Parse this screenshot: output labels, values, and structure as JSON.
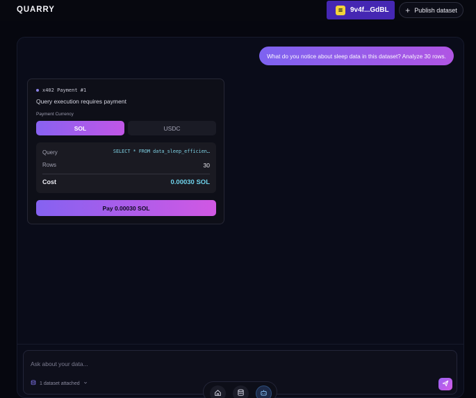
{
  "header": {
    "logo": "QUARRY",
    "wallet_label": "9v4f...GdBL",
    "publish_label": "Publish dataset"
  },
  "chat": {
    "user_message": "What do you notice about sleep data in this dataset? Analyze 30 rows."
  },
  "payment": {
    "tag": "x402 Payment #1",
    "description": "Query execution requires payment",
    "currency_label": "Payment Currency",
    "currencies": [
      {
        "label": "SOL",
        "selected": true
      },
      {
        "label": "USDC",
        "selected": false
      }
    ],
    "query_label": "Query",
    "query_value": "SELECT * FROM data_sleep_efficien…",
    "rows_label": "Rows",
    "rows_value": "30",
    "cost_label": "Cost",
    "cost_value": "0.00030 SOL",
    "pay_button": "Pay 0.00030 SOL"
  },
  "input": {
    "placeholder": "Ask about your data...",
    "attached_label": "1 dataset attached"
  },
  "colors": {
    "accent_start": "#8562f1",
    "accent_end": "#d158e3",
    "wallet_bg": "#4527b3",
    "cost_color": "#6fd2ea",
    "background": "#06070f"
  },
  "icons": {
    "wallet": "solana-icon",
    "publish": "plus-icon",
    "attached": "database-icon",
    "send": "send-icon",
    "nav": [
      "home-icon",
      "database-icon",
      "bot-icon"
    ]
  }
}
